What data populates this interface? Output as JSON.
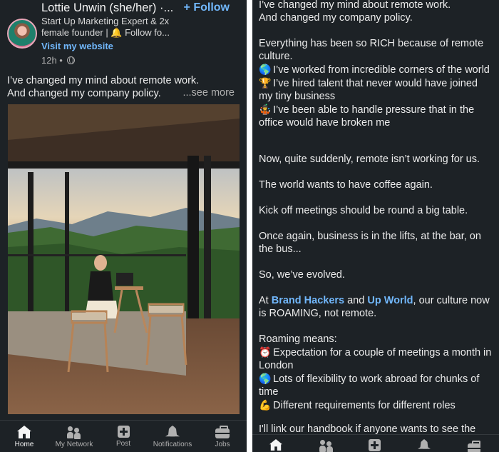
{
  "left": {
    "author": "Lottie Unwin (she/her) ·...",
    "follow": "+ Follow",
    "headline": "Start Up Marketing Expert & 2x female founder | 🔔 Follow fo...",
    "website": "Visit my website",
    "timestamp": "12h •",
    "post_line1": "I’ve changed my mind about remote work.",
    "post_line2": "And changed my company policy.",
    "see_more": "...see more",
    "nav": [
      {
        "label": "Home",
        "icon": "home-icon",
        "active": true
      },
      {
        "label": "My Network",
        "icon": "network-icon",
        "active": false
      },
      {
        "label": "Post",
        "icon": "post-icon",
        "active": false
      },
      {
        "label": "Notifications",
        "icon": "bell-icon",
        "active": false
      },
      {
        "label": "Jobs",
        "icon": "briefcase-icon",
        "active": false
      }
    ]
  },
  "right": {
    "p1a": "I’ve changed my mind about remote work.",
    "p1b": "And changed my company policy.",
    "p2": "Everything has been so RICH because of remote culture.",
    "p2_item1": "I’ve worked from incredible corners of the world",
    "p2_item2": "I’ve hired talent that never would have joined my tiny business",
    "p2_item3": "I’ve been able to handle pressure that in the office would have broken me",
    "p3": "Now, quite suddenly, remote isn’t working for us.",
    "p4": "The world wants to have coffee again.",
    "p5": "Kick off meetings should be round a big table.",
    "p6": "Once again, business is in the lifts, at the bar, on the bus...",
    "p7": "So, we’ve evolved.",
    "p8_pre": "At ",
    "p8_link1": "Brand Hackers",
    "p8_mid": " and ",
    "p8_link2": "Up World",
    "p8_post": ", our culture now is ROAMING, not remote.",
    "p9": "Roaming means:",
    "p9_item1": "Expectation for a couple of meetings a month in London",
    "p9_item2": "Lots of flexibility to work abroad for chunks of time",
    "p9_item3": "Different requirements for different roles",
    "p10": "I'll link our handbook if anyone wants to see the",
    "emoji": {
      "globe": "🌎",
      "trophy": "🏆",
      "juggler": "🤹",
      "alarm": "⏰",
      "muscle": "💪"
    }
  },
  "colors": {
    "bg": "#1d2226",
    "link": "#71b7fb",
    "text": "#ececec",
    "muted": "#b0b0b0"
  }
}
